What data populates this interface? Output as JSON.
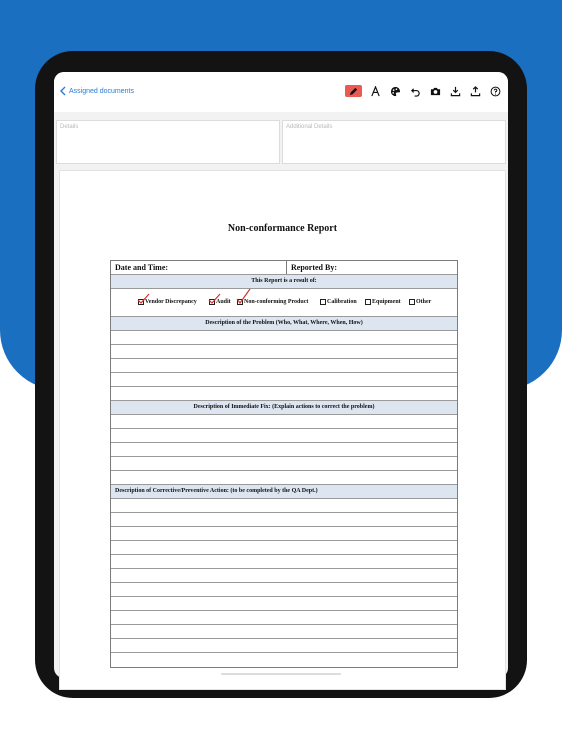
{
  "header": {
    "back_label": "Assigned documents",
    "tools": [
      "pencil-icon",
      "text-icon",
      "palette-icon",
      "undo-icon",
      "camera-icon",
      "download-icon",
      "upload-icon",
      "help-icon"
    ]
  },
  "fields": {
    "details_placeholder": "Details",
    "additional_placeholder": "Additional Details"
  },
  "document": {
    "title": "Non-conformance Report",
    "date_time_label": "Date and Time:",
    "reported_by_label": "Reported By:",
    "result_of_header": "This Report is a result of:",
    "options": [
      {
        "label": "Vendor Discrepancy",
        "checked": true
      },
      {
        "label": "Audit",
        "checked": true
      },
      {
        "label": "Non-conforming Product",
        "checked": true
      },
      {
        "label": "Calibration",
        "checked": false
      },
      {
        "label": "Equipment",
        "checked": false
      },
      {
        "label": "Other",
        "checked": false
      }
    ],
    "problem_header": "Description of the Problem (Who, What, Where, When, How)",
    "immediate_fix_header": "Description of Immediate Fix: (Explain actions to correct the problem)",
    "corrective_header": "Description of Corrective/Preventive Action: (to be completed by the QA Dept.)"
  },
  "colors": {
    "brand_blue": "#1a6fc0",
    "annotation_red": "#d9302c",
    "section_fill": "#dce5f0",
    "active_tool": "#e85a54"
  }
}
